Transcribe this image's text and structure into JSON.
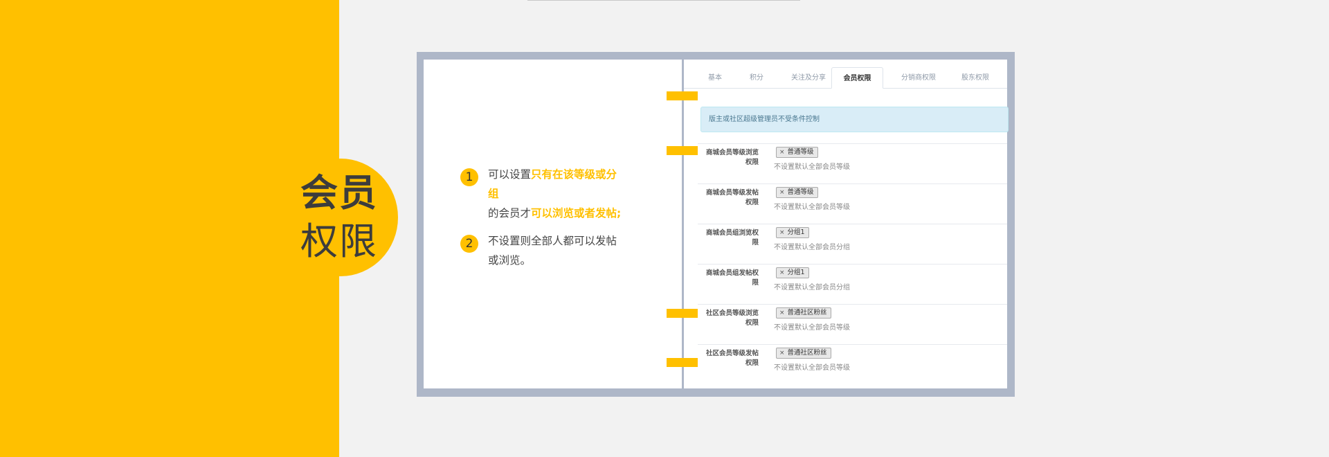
{
  "title": {
    "line1": "会员",
    "line2": "权限"
  },
  "notes": [
    {
      "num": "1",
      "parts": [
        {
          "text": "可以设置",
          "hl": false
        },
        {
          "text": "只有在该等级或分组",
          "hl": true
        },
        {
          "text": "的会员才",
          "hl": false
        },
        {
          "text": "可以浏览或者发帖;",
          "hl": true
        }
      ]
    },
    {
      "num": "2",
      "parts": [
        {
          "text": "不设置则全部人都可以发帖或浏览。",
          "hl": false
        }
      ]
    }
  ],
  "tabs": [
    {
      "label": "基本",
      "active": false
    },
    {
      "label": "积分",
      "active": false
    },
    {
      "label": "关注及分享",
      "active": false
    },
    {
      "label": "会员权限",
      "active": true
    },
    {
      "label": "分销商权限",
      "active": false
    },
    {
      "label": "股东权限",
      "active": false
    }
  ],
  "info": "版主或社区超级管理员不受条件控制",
  "rows": [
    {
      "label_a": "商城会员等级浏览",
      "label_b": "权限",
      "tag": "普通等级",
      "hint": "不设置默认全部会员等级"
    },
    {
      "label_a": "商城会员等级发帖",
      "label_b": "权限",
      "tag": "普通等级",
      "hint": "不设置默认全部会员等级"
    },
    {
      "label_a": "商城会员组浏览权",
      "label_b": "限",
      "tag": "分组1",
      "hint": "不设置默认全部会员分组"
    },
    {
      "label_a": "商城会员组发帖权",
      "label_b": "限",
      "tag": "分组1",
      "hint": "不设置默认全部会员分组"
    },
    {
      "label_a": "社区会员等级浏览",
      "label_b": "权限",
      "tag": "普通社区粉丝",
      "hint": "不设置默认全部会员等级"
    },
    {
      "label_a": "社区会员等级发帖",
      "label_b": "权限",
      "tag": "普通社区粉丝",
      "hint": "不设置默认全部会员等级"
    }
  ],
  "colors": {
    "accent": "#ffc000",
    "frame": "#aeb7c8",
    "background": "#f2f2f2",
    "info_bg": "#d9edf7"
  }
}
